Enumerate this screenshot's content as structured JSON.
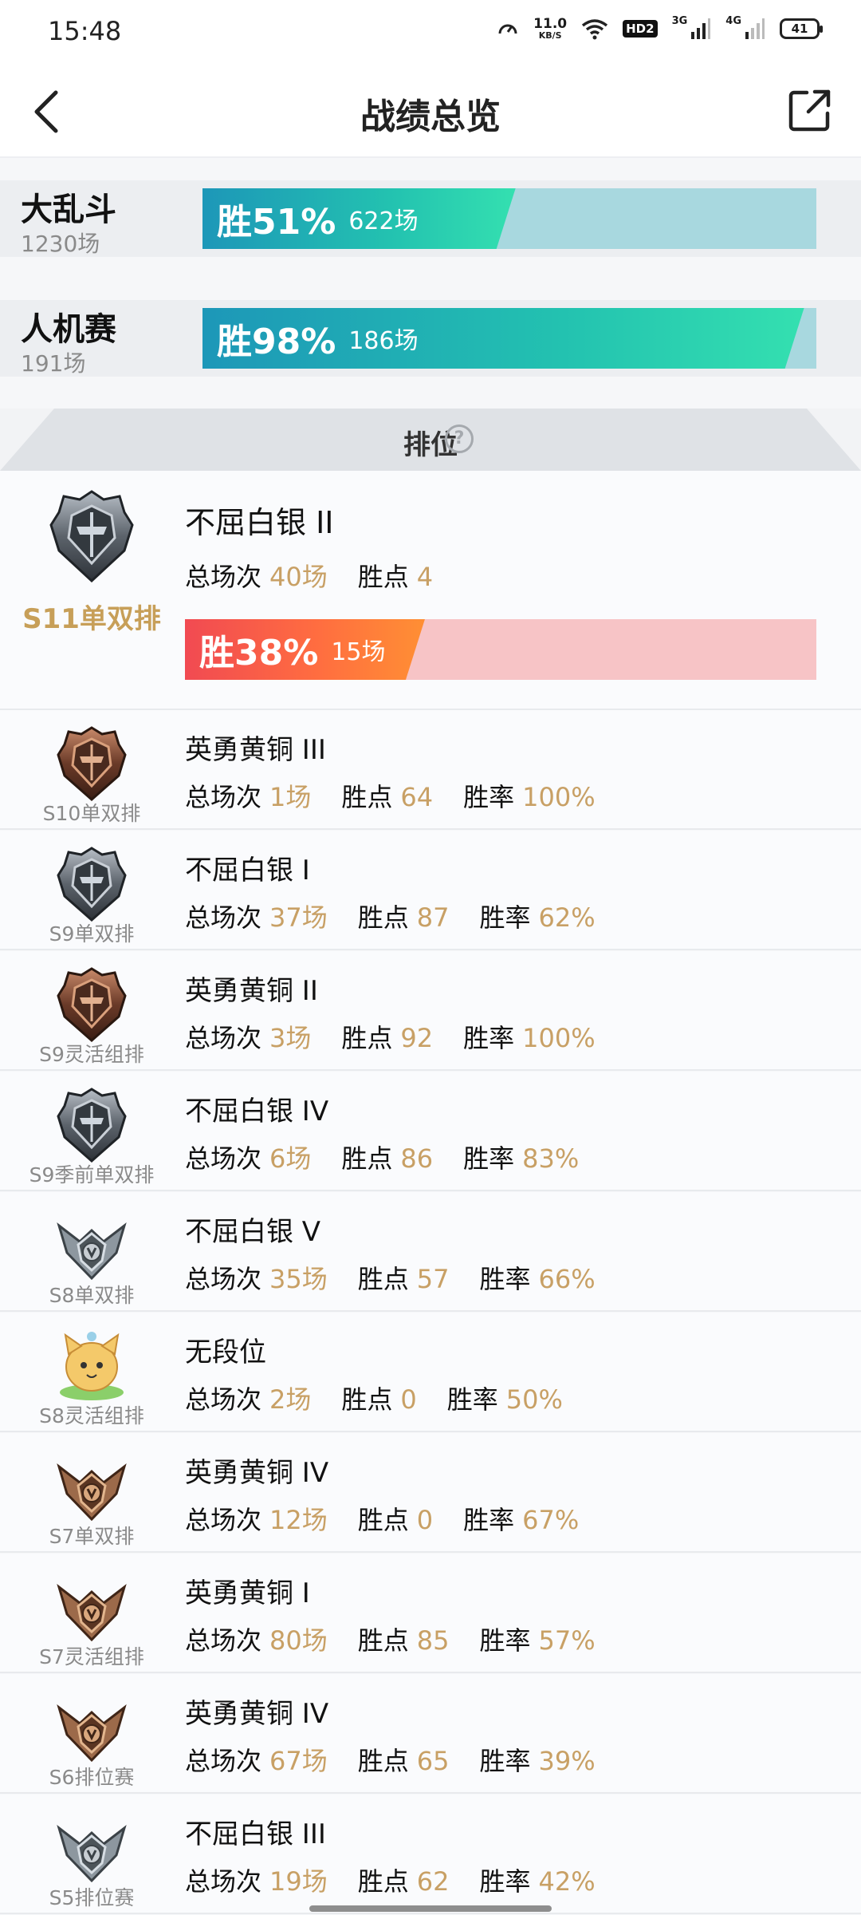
{
  "status_bar": {
    "time": "15:48",
    "speed_value": "11.0",
    "speed_unit": "KB/S",
    "hd": "HD2",
    "net1": "3G",
    "net2": "4G",
    "battery": "41"
  },
  "header": {
    "title": "战绩总览",
    "back_icon": "chevron-left-icon",
    "share_icon": "share-external-icon"
  },
  "modes": [
    {
      "name": "大乱斗",
      "count": "1230场",
      "win_pct": "胜51%",
      "win_games": "622场",
      "win_fraction": 0.51,
      "color": "#1d97b8"
    },
    {
      "name": "人机赛",
      "count": "191场",
      "win_pct": "胜98%",
      "win_games": "186场",
      "win_fraction": 0.98,
      "color": "#23c2b0"
    }
  ],
  "section": {
    "title": "排位",
    "help": "?"
  },
  "current": {
    "season": "S11单双排",
    "rank": "不屈白银 II",
    "total_label": "总场次",
    "total": "40场",
    "points_label": "胜点",
    "points": "4",
    "win_pct": "胜38%",
    "win_games": "15场",
    "win_fraction": 0.38,
    "badge": "silver"
  },
  "labels": {
    "total": "总场次",
    "points": "胜点",
    "rate": "胜率"
  },
  "history": [
    {
      "season": "S10单双排",
      "rank": "英勇黄铜 III",
      "total": "1场",
      "points": "64",
      "rate": "100%",
      "badge": "bronze"
    },
    {
      "season": "S9单双排",
      "rank": "不屈白银 I",
      "total": "37场",
      "points": "87",
      "rate": "62%",
      "badge": "silver"
    },
    {
      "season": "S9灵活组排",
      "rank": "英勇黄铜 II",
      "total": "3场",
      "points": "92",
      "rate": "100%",
      "badge": "bronze"
    },
    {
      "season": "S9季前单双排",
      "rank": "不屈白银 IV",
      "total": "6场",
      "points": "86",
      "rate": "83%",
      "badge": "silver"
    },
    {
      "season": "S8单双排",
      "rank": "不屈白银 V",
      "total": "35场",
      "points": "57",
      "rate": "66%",
      "badge": "silver-winged"
    },
    {
      "season": "S8灵活组排",
      "rank": "无段位",
      "total": "2场",
      "points": "0",
      "rate": "50%",
      "badge": "unranked"
    },
    {
      "season": "S7单双排",
      "rank": "英勇黄铜 IV",
      "total": "12场",
      "points": "0",
      "rate": "67%",
      "badge": "bronze-winged"
    },
    {
      "season": "S7灵活组排",
      "rank": "英勇黄铜 I",
      "total": "80场",
      "points": "85",
      "rate": "57%",
      "badge": "bronze-winged"
    },
    {
      "season": "S6排位赛",
      "rank": "英勇黄铜 IV",
      "total": "67场",
      "points": "65",
      "rate": "39%",
      "badge": "bronze-winged"
    },
    {
      "season": "S5排位赛",
      "rank": "不屈白银 III",
      "total": "19场",
      "points": "62",
      "rate": "42%",
      "badge": "silver-winged"
    }
  ]
}
